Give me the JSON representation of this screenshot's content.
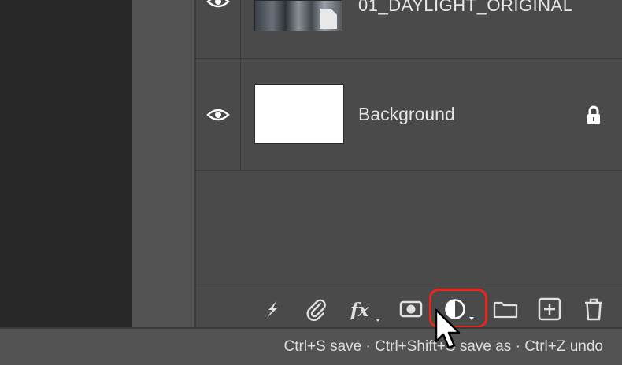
{
  "layers": [
    {
      "name": "01_DAYLIGHT_ORIGINAL",
      "visible": true,
      "locked": false
    },
    {
      "name": "Background",
      "visible": true,
      "locked": true
    }
  ],
  "toolbar": {
    "buttons": [
      {
        "name": "link-layers",
        "icon": "lightning-link-icon"
      },
      {
        "name": "attach",
        "icon": "paperclip-icon"
      },
      {
        "name": "layer-effects",
        "icon": "fx-icon"
      },
      {
        "name": "add-mask",
        "icon": "mask-icon"
      },
      {
        "name": "adjustment-layer",
        "icon": "half-circle-icon",
        "highlighted": true
      },
      {
        "name": "new-group",
        "icon": "folder-icon"
      },
      {
        "name": "new-layer",
        "icon": "plus-square-icon"
      },
      {
        "name": "delete-layer",
        "icon": "trash-icon"
      }
    ]
  },
  "status": {
    "shortcuts": "Ctrl+S save · Ctrl+Shift+S save as · Ctrl+Z undo"
  },
  "colors": {
    "highlight": "#e8261c",
    "panel": "#4a4a4a",
    "canvas": "#282828"
  }
}
